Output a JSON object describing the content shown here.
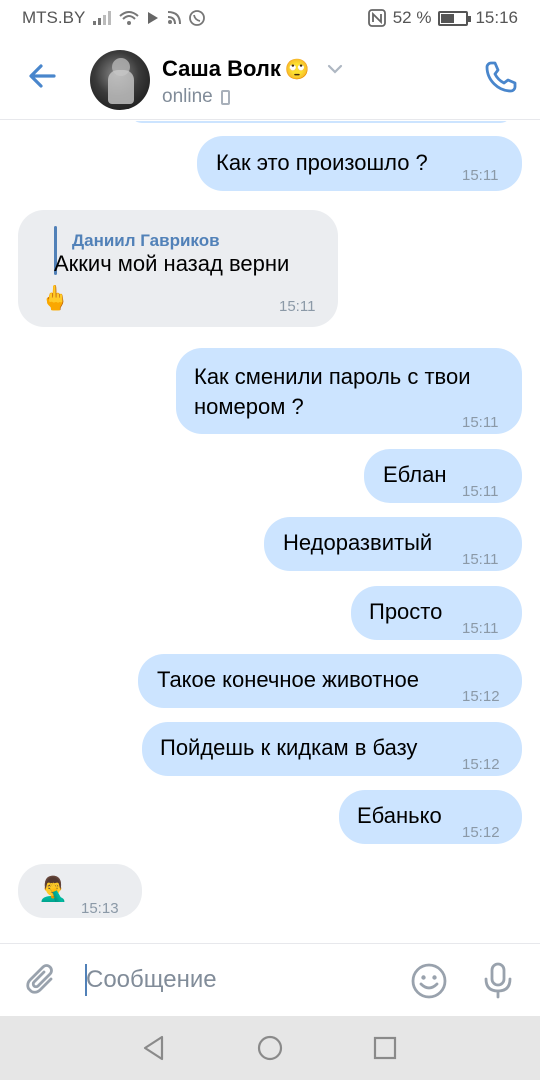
{
  "status_bar": {
    "carrier": "MTS.BY",
    "battery_text": "52 %",
    "battery_level": 0.52,
    "time": "15:16",
    "icons": [
      "signal-icon",
      "wifi-icon",
      "play-icon",
      "rss-icon",
      "whatsapp-icon",
      "nfc-icon",
      "battery-icon"
    ]
  },
  "header": {
    "contact_name": "Саша Волк",
    "name_emoji": "🙄",
    "status": "online",
    "back_icon": "arrow-left-icon",
    "call_icon": "phone-icon"
  },
  "messages": [
    {
      "dir": "out",
      "text": "Как это произошло ?",
      "time": "15:11"
    },
    {
      "dir": "in",
      "reply_to": "Даниил Гавриков",
      "text": "Аккич мой назад верни",
      "emoji": "🖕",
      "time": "15:11"
    },
    {
      "dir": "out",
      "lines": [
        "Как сменили пароль с твои",
        "номером ?"
      ],
      "time": "15:11"
    },
    {
      "dir": "out",
      "text": "Еблан",
      "time": "15:11"
    },
    {
      "dir": "out",
      "text": "Недоразвитый",
      "time": "15:11"
    },
    {
      "dir": "out",
      "text": "Просто",
      "time": "15:11"
    },
    {
      "dir": "out",
      "text": "Такое конечное животное",
      "time": "15:12"
    },
    {
      "dir": "out",
      "text": "Пойдешь к кидкам в базу",
      "time": "15:12"
    },
    {
      "dir": "out",
      "text": "Ебанько",
      "time": "15:12"
    },
    {
      "dir": "in",
      "emoji": "🤦‍♂️",
      "time": "15:13"
    }
  ],
  "composer": {
    "placeholder": "Сообщение",
    "value": ""
  },
  "colors": {
    "accent": "#5181b8",
    "outgoing_bubble": "#cce4ff",
    "incoming_bubble": "#ebedf0",
    "time_text": "#8b99a7",
    "nav_bar": "#e6e6e6"
  }
}
